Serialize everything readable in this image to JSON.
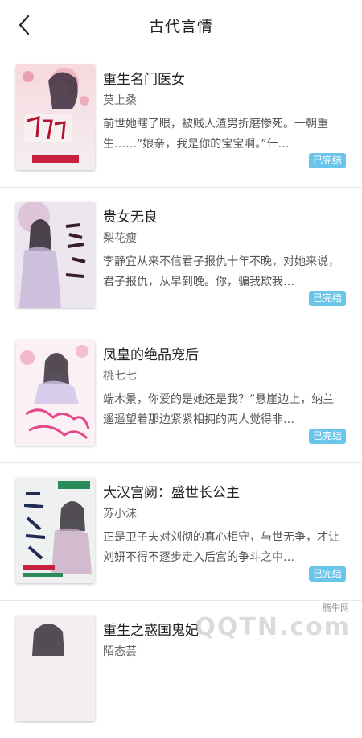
{
  "header": {
    "title": "古代言情",
    "back_icon": "chevron-left-icon"
  },
  "books": [
    {
      "title": "重生名门医女",
      "author": "莫上桑",
      "description": "前世她瞎了眼，被贱人渣男折磨惨死。一朝重生……“娘亲，我是你的宝宝啊。”什…",
      "status": "已完结"
    },
    {
      "title": "贵女无良",
      "author": "梨花瘦",
      "description": "李静宜从来不信君子报仇十年不晚，对她来说，君子报仇，从早到晚。你，骗我欺我…",
      "status": "已完结"
    },
    {
      "title": "凤皇的绝品宠后",
      "author": "桃七七",
      "description": "端木景，你爱的是她还是我？”悬崖边上，纳兰遥遥望着那边紧紧相拥的两人觉得非…",
      "status": "已完结"
    },
    {
      "title": "大汉宫阙：盛世长公主",
      "author": "苏小沫",
      "description": "正是卫子夫对刘彻的真心相守，与世无争，才让刘妍不得不逐步走入后宫的争斗之中…",
      "status": "已完结"
    },
    {
      "title": "重生之惑国鬼妃",
      "author": "陌态芸",
      "description": "",
      "status": ""
    }
  ],
  "watermark": {
    "small_text": "腾牛网",
    "big_text": "QQTN.com"
  },
  "colors": {
    "badge": "#69c6ea",
    "divider": "#e9e9e9"
  }
}
